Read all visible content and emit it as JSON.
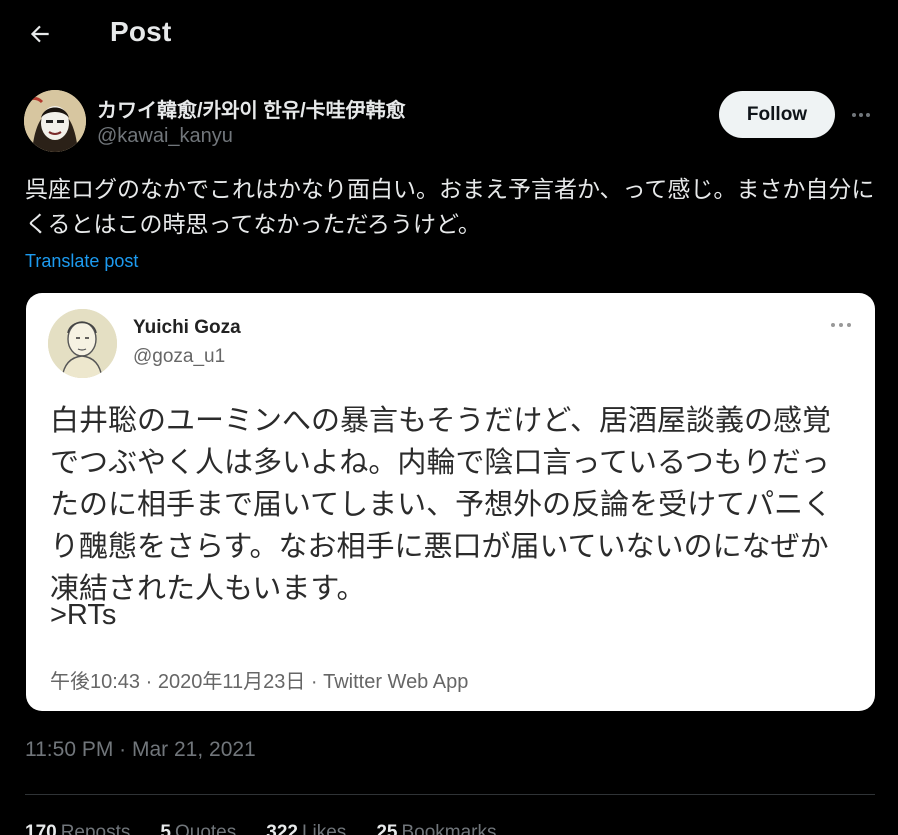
{
  "header": {
    "title": "Post",
    "back_icon": "arrow-left-icon"
  },
  "post": {
    "author_name": "カワイ韓愈/카와이 한유/卡哇伊韩愈",
    "author_handle": "@kawai_kanyu",
    "follow_label": "Follow",
    "more_icon": "ellipsis-icon",
    "text": "呉座ログのなかでこれはかなり面白い。おまえ予言者か、って感じ。まさか自分にくるとはこの時思ってなかっただろうけど。",
    "translate_label": "Translate post",
    "timestamp": "11:50 PM · Mar 21, 2021"
  },
  "embedded": {
    "name": "Yuichi Goza",
    "handle": "@goza_u1",
    "text": "白井聡のユーミンへの暴言もそうだけど、居酒屋談義の感覚でつぶやく人は多いよね。内輪で陰口言っているつもりだったのに相手まで届いてしまい、予想外の反論を受けてパニくり醜態をさらす。なお相手に悪口が届いていないのになぜか凍結された人もいます。",
    "rts": ">RTs",
    "meta": "午後10:43 · 2020年11月23日 · Twitter Web App"
  },
  "stats": {
    "reposts_count": "170",
    "reposts_label": "Reposts",
    "quotes_count": "5",
    "quotes_label": "Quotes",
    "likes_count": "322",
    "likes_label": "Likes",
    "bookmarks_count": "25",
    "bookmarks_label": "Bookmarks"
  },
  "colors": {
    "background": "#000000",
    "accent": "#1d9bf0",
    "secondary_text": "#71767b"
  }
}
